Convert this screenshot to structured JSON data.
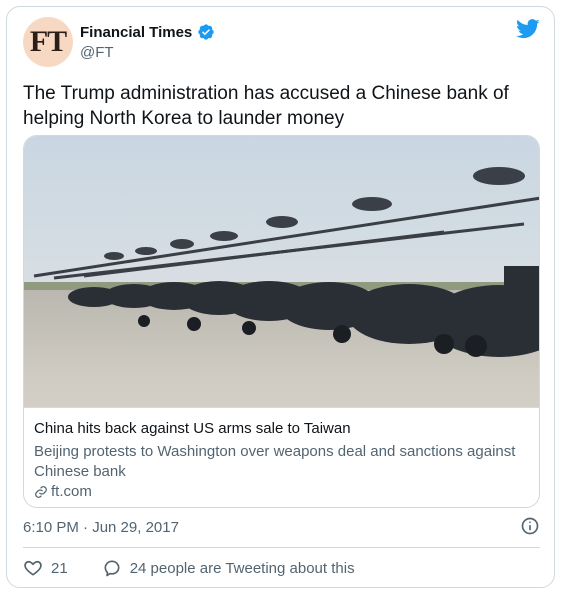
{
  "tweet": {
    "author": {
      "avatar_text": "FT",
      "display_name": "Financial Times",
      "handle": "@FT",
      "verified": true
    },
    "text": "The Trump administration has accused a Chinese bank of helping North Korea to launder money",
    "timestamp": "6:10 PM · Jun 29, 2017",
    "link_card": {
      "title": "China hits back against US arms sale to Taiwan",
      "description": "Beijing protests to Washington over weapons deal and sanctions against Chinese bank",
      "domain": "ft.com",
      "image_subject": "row of parked attack helicopters on a runway"
    },
    "stats": {
      "likes": "21",
      "tweeting_text": "24 people are Tweeting about this"
    }
  },
  "icons": {
    "logo": "twitter-bird-icon",
    "verified": "verified-badge-icon",
    "link": "link-icon",
    "info": "info-icon",
    "like": "heart-icon",
    "reply": "speech-bubble-icon"
  },
  "colors": {
    "brand_blue": "#1d9bf0",
    "text_primary": "#0f1419",
    "text_secondary": "#536471",
    "border": "#cfd9de",
    "avatar_bg": "#f7d9c3"
  }
}
